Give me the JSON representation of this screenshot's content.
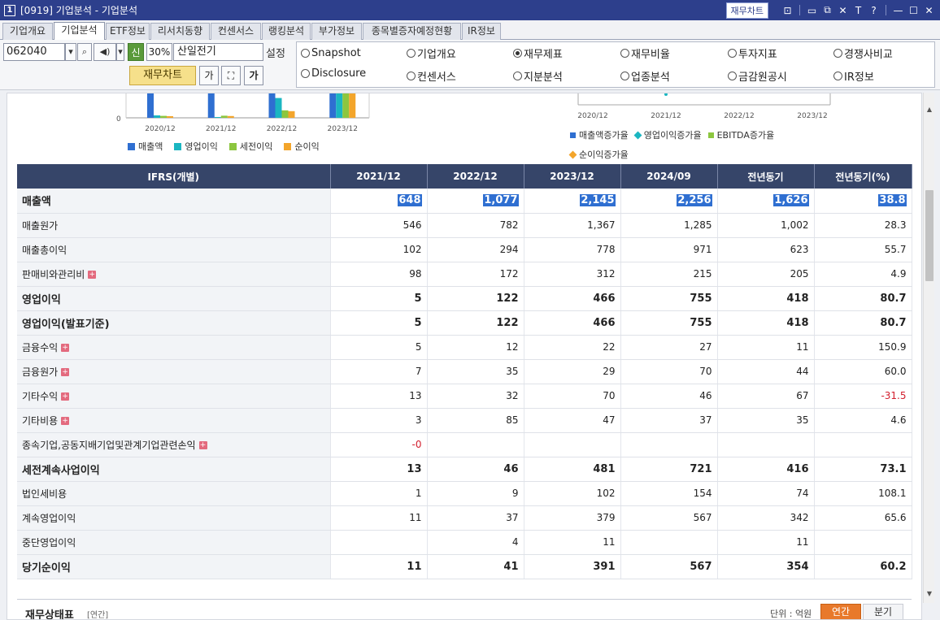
{
  "titlebar": {
    "window_number": "1",
    "title": "[0919] 기업분석 - 기업분석",
    "chart_button": "재무차트",
    "icons": [
      "window-icon",
      "layout-icon",
      "layout2-icon",
      "tools-icon",
      "text-size-icon",
      "help-icon",
      "minimize-icon",
      "maximize-icon",
      "close-icon"
    ],
    "icon_glyphs": [
      "⊡",
      "▭",
      "⧉",
      "✕",
      "T",
      "?",
      "—",
      "☐",
      "✕"
    ]
  },
  "tabs": [
    {
      "label": "기업개요",
      "active": false
    },
    {
      "label": "기업분석",
      "active": true
    },
    {
      "label": "ETF정보",
      "active": false
    },
    {
      "label": "리서치동향",
      "active": false
    },
    {
      "label": "컨센서스",
      "active": false
    },
    {
      "label": "랭킹분석",
      "active": false
    },
    {
      "label": "부가정보",
      "active": false
    },
    {
      "label": "종목별증자예정현황",
      "active": false
    },
    {
      "label": "IR정보",
      "active": false
    }
  ],
  "controls": {
    "stock_code": "062040",
    "new_badge": "신",
    "percent": "30%",
    "stock_name": "산일전기",
    "settings_label": "설정",
    "finance_chart_button": "재무차트",
    "font_button": "가",
    "font_button2": "가"
  },
  "radios": [
    {
      "label": "Snapshot",
      "selected": false
    },
    {
      "label": "기업개요",
      "selected": false
    },
    {
      "label": "재무제표",
      "selected": true
    },
    {
      "label": "재무비율",
      "selected": false
    },
    {
      "label": "투자지표",
      "selected": false
    },
    {
      "label": "경쟁사비교",
      "selected": false
    },
    {
      "label": "Disclosure",
      "selected": false
    },
    {
      "label": "컨센서스",
      "selected": false
    },
    {
      "label": "지분분석",
      "selected": false
    },
    {
      "label": "업종분석",
      "selected": false
    },
    {
      "label": "금감원공시",
      "selected": false
    },
    {
      "label": "IR정보",
      "selected": false
    }
  ],
  "chart_data": [
    {
      "type": "bar",
      "categories": [
        "2020/12",
        "2021/12",
        "2022/12",
        "2023/12"
      ],
      "y_tick_labels": [
        "0"
      ],
      "series": [
        {
          "name": "매출액",
          "color": "#2f6fd1",
          "values": [
            520,
            648,
            1077,
            2145
          ]
        },
        {
          "name": "영업이익",
          "color": "#1bb6c1",
          "values": [
            15,
            5,
            122,
            466
          ]
        },
        {
          "name": "세전이익",
          "color": "#8cc63f",
          "values": [
            12,
            13,
            46,
            481
          ]
        },
        {
          "name": "순이익",
          "color": "#f3a52b",
          "values": [
            10,
            11,
            41,
            391
          ]
        }
      ],
      "ylim": [
        0,
        2500
      ],
      "legend_position": "bottom"
    },
    {
      "type": "line",
      "categories": [
        "2020/12",
        "2021/12",
        "2022/12",
        "2023/12"
      ],
      "series": [
        {
          "name": "매출액증가율",
          "color": "#2f6fd1"
        },
        {
          "name": "영업이익증가율",
          "color": "#1bb6c1"
        },
        {
          "name": "EBITDA증가율",
          "color": "#8cc63f"
        },
        {
          "name": "순이익증가율",
          "color": "#f3a52b"
        }
      ],
      "legend_position": "bottom"
    }
  ],
  "table": {
    "header_label": "IFRS(개별)",
    "columns": [
      "2021/12",
      "2022/12",
      "2023/12",
      "2024/09",
      "전년동기",
      "전년동기(%)"
    ],
    "rows": [
      {
        "label": "매출액",
        "bold": true,
        "highlight": true,
        "expand": false,
        "values": [
          "648",
          "1,077",
          "2,145",
          "2,256",
          "1,626",
          "38.8"
        ]
      },
      {
        "label": "매출원가",
        "bold": false,
        "expand": false,
        "values": [
          "546",
          "782",
          "1,367",
          "1,285",
          "1,002",
          "28.3"
        ]
      },
      {
        "label": "매출총이익",
        "bold": false,
        "expand": false,
        "values": [
          "102",
          "294",
          "778",
          "971",
          "623",
          "55.7"
        ]
      },
      {
        "label": "판매비와관리비",
        "bold": false,
        "expand": true,
        "values": [
          "98",
          "172",
          "312",
          "215",
          "205",
          "4.9"
        ]
      },
      {
        "label": "영업이익",
        "bold": true,
        "sep": true,
        "expand": false,
        "values": [
          "5",
          "122",
          "466",
          "755",
          "418",
          "80.7"
        ]
      },
      {
        "label": "영업이익(발표기준)",
        "bold": true,
        "expand": false,
        "values": [
          "5",
          "122",
          "466",
          "755",
          "418",
          "80.7"
        ]
      },
      {
        "label": "금융수익",
        "bold": false,
        "expand": true,
        "values": [
          "5",
          "12",
          "22",
          "27",
          "11",
          "150.9"
        ]
      },
      {
        "label": "금융원가",
        "bold": false,
        "expand": true,
        "values": [
          "7",
          "35",
          "29",
          "70",
          "44",
          "60.0"
        ]
      },
      {
        "label": "기타수익",
        "bold": false,
        "expand": true,
        "values": [
          "13",
          "32",
          "70",
          "46",
          "67",
          "-31.5"
        ]
      },
      {
        "label": "기타비용",
        "bold": false,
        "expand": true,
        "values": [
          "3",
          "85",
          "47",
          "37",
          "35",
          "4.6"
        ]
      },
      {
        "label": "종속기업,공동지배기업및관계기업관련손익",
        "bold": false,
        "expand": true,
        "values": [
          "-0",
          "",
          "",
          "",
          "",
          ""
        ]
      },
      {
        "label": "세전계속사업이익",
        "bold": true,
        "sep": true,
        "expand": false,
        "values": [
          "13",
          "46",
          "481",
          "721",
          "416",
          "73.1"
        ]
      },
      {
        "label": "법인세비용",
        "bold": false,
        "expand": false,
        "values": [
          "1",
          "9",
          "102",
          "154",
          "74",
          "108.1"
        ]
      },
      {
        "label": "계속영업이익",
        "bold": false,
        "expand": false,
        "values": [
          "11",
          "37",
          "379",
          "567",
          "342",
          "65.6"
        ]
      },
      {
        "label": "중단영업이익",
        "bold": false,
        "expand": false,
        "values": [
          "",
          "4",
          "11",
          "",
          "11",
          ""
        ]
      },
      {
        "label": "당기순이익",
        "bold": true,
        "expand": false,
        "values": [
          "11",
          "41",
          "391",
          "567",
          "354",
          "60.2"
        ]
      }
    ]
  },
  "footer": {
    "title": "재무상태표",
    "subtitle": "[연간]",
    "unit": "단위 : 억원",
    "annual": "연간",
    "quarter": "분기"
  }
}
